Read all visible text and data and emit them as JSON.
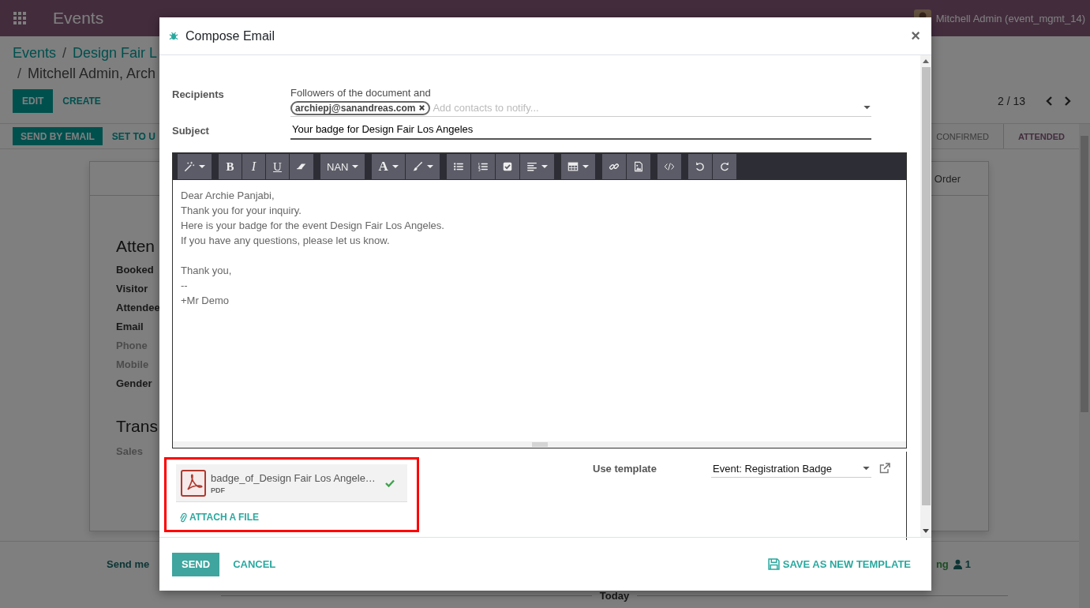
{
  "navbar": {
    "app_name": "Events",
    "user": "Mitchell Admin (event_mgmt_14)"
  },
  "breadcrumb": {
    "parent": "Events",
    "separator": "/",
    "record": "Design Fair L",
    "current": "Mitchell Admin, Arch"
  },
  "actions": [
    {
      "label": "EDIT",
      "primary": true
    },
    {
      "label": "CREATE",
      "primary": false
    }
  ],
  "pager": "2 / 13",
  "header_buttons": [
    {
      "label": "SEND BY EMAIL",
      "primary": true
    },
    {
      "label": "SET TO U",
      "primary": false
    }
  ],
  "stages": [
    {
      "label": "CONFIRMED",
      "selected": false
    },
    {
      "label": "ATTENDED",
      "selected": true
    }
  ],
  "sheet": {
    "stat_button": "Order",
    "title": "Atten",
    "fields": [
      {
        "label": "Booked",
        "muted": false
      },
      {
        "label": "Visitor",
        "muted": false
      },
      {
        "label": "Attendee",
        "muted": false
      },
      {
        "label": "Email",
        "muted": false
      },
      {
        "label": "Phone",
        "muted": true
      },
      {
        "label": "Mobile",
        "muted": true
      },
      {
        "label": "Gender",
        "muted": false
      }
    ],
    "section_title": "Trans",
    "section_fields": [
      {
        "label": "Sales",
        "muted": true
      }
    ]
  },
  "chatter": {
    "send_message": "Send me",
    "activity": "ng",
    "followers": "1",
    "date_separator": "Today"
  },
  "dialog": {
    "title": "Compose Email",
    "close": "×",
    "recipients_label": "Recipients",
    "followers_text": "Followers of the document and",
    "recipients": [
      {
        "label": "archiepj@sanandreas.com"
      }
    ],
    "recipients_placeholder": "Add contacts to notify...",
    "subject_label": "Subject",
    "subject": "Your badge for Design Fair Los Angeles",
    "toolbar": [
      {
        "buttons": [
          {
            "kind": "magic",
            "caret": true
          }
        ]
      },
      {
        "buttons": [
          {
            "kind": "bold",
            "label": "B"
          },
          {
            "kind": "italic",
            "label": "I"
          },
          {
            "kind": "underline",
            "label": "U"
          },
          {
            "kind": "eraser"
          }
        ]
      },
      {
        "buttons": [
          {
            "kind": "font-size",
            "label": "NAN",
            "caret": true
          }
        ]
      },
      {
        "buttons": [
          {
            "kind": "font-color",
            "label": "A",
            "caret": true
          },
          {
            "kind": "brush",
            "caret": true
          }
        ]
      },
      {
        "buttons": [
          {
            "kind": "bullet-list"
          },
          {
            "kind": "number-list"
          },
          {
            "kind": "checklist"
          },
          {
            "kind": "align",
            "caret": true
          }
        ]
      },
      {
        "buttons": [
          {
            "kind": "table",
            "caret": true
          }
        ]
      },
      {
        "buttons": [
          {
            "kind": "link"
          },
          {
            "kind": "image"
          }
        ]
      },
      {
        "buttons": [
          {
            "kind": "code"
          }
        ]
      },
      {
        "buttons": [
          {
            "kind": "undo"
          },
          {
            "kind": "redo"
          }
        ]
      }
    ],
    "body": [
      [
        "Dear Archie Panjabi,",
        "Thank you for your inquiry.",
        "Here is your badge for the event Design Fair Los Angeles.",
        "If you have any questions, please let us know."
      ],
      [
        "Thank you,",
        "--",
        "+Mr Demo"
      ]
    ],
    "attachments": [
      {
        "name": "badge_of_Design Fair Los Angele…",
        "type": "PDF",
        "uploaded": true
      }
    ],
    "attachments_highlighted": true,
    "attach_label": "ATTACH A FILE",
    "template_label": "Use template",
    "template": "Event: Registration Badge",
    "send": "SEND",
    "cancel": "CANCEL",
    "save_template": "SAVE AS NEW TEMPLATE"
  }
}
